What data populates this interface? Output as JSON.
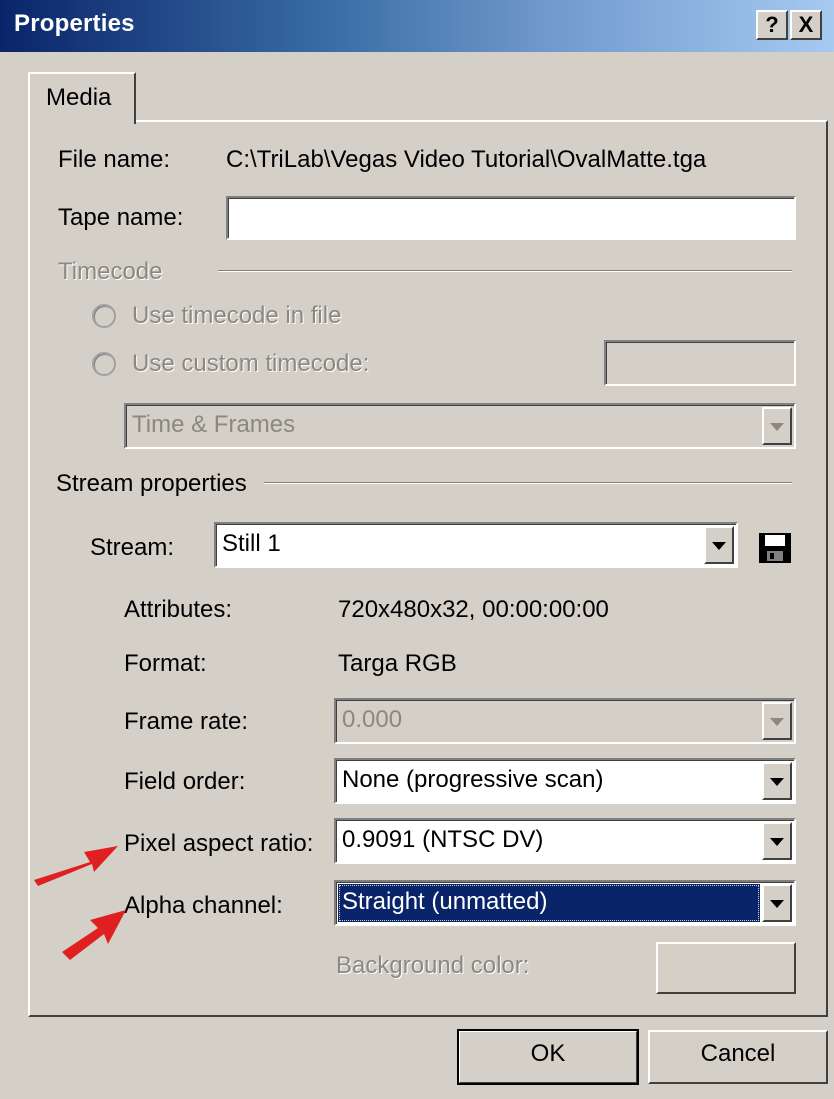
{
  "window": {
    "title": "Properties",
    "help_label": "?",
    "close_label": "X"
  },
  "tabs": [
    {
      "label": "Media"
    }
  ],
  "media": {
    "file_name_label": "File name:",
    "file_name_value": "C:\\TriLab\\Vegas Video Tutorial\\OvalMatte.tga",
    "tape_name_label": "Tape name:",
    "tape_name_value": "",
    "timecode": {
      "group_label": "Timecode",
      "use_file_label": "Use timecode in file",
      "use_custom_label": "Use custom timecode:",
      "custom_value": "",
      "format_value": "Time & Frames"
    },
    "stream_properties": {
      "group_label": "Stream properties",
      "stream_label": "Stream:",
      "stream_value": "Still 1",
      "save_icon": "floppy-disk-icon",
      "attributes_label": "Attributes:",
      "attributes_value": "720x480x32, 00:00:00:00",
      "format_label": "Format:",
      "format_value": "Targa RGB",
      "frame_rate_label": "Frame rate:",
      "frame_rate_value": "0.000",
      "field_order_label": "Field order:",
      "field_order_value": "None (progressive scan)",
      "pixel_aspect_label": "Pixel aspect ratio:",
      "pixel_aspect_value": "0.9091 (NTSC DV)",
      "alpha_label": "Alpha channel:",
      "alpha_value": "Straight (unmatted)",
      "background_color_label": "Background color:"
    }
  },
  "buttons": {
    "ok": "OK",
    "cancel": "Cancel"
  },
  "colors": {
    "title_start": "#0a246a",
    "title_end": "#a6caf0",
    "selection": "#0a246a",
    "annotation_arrow": "#e02020",
    "face": "#d4d0c8"
  }
}
